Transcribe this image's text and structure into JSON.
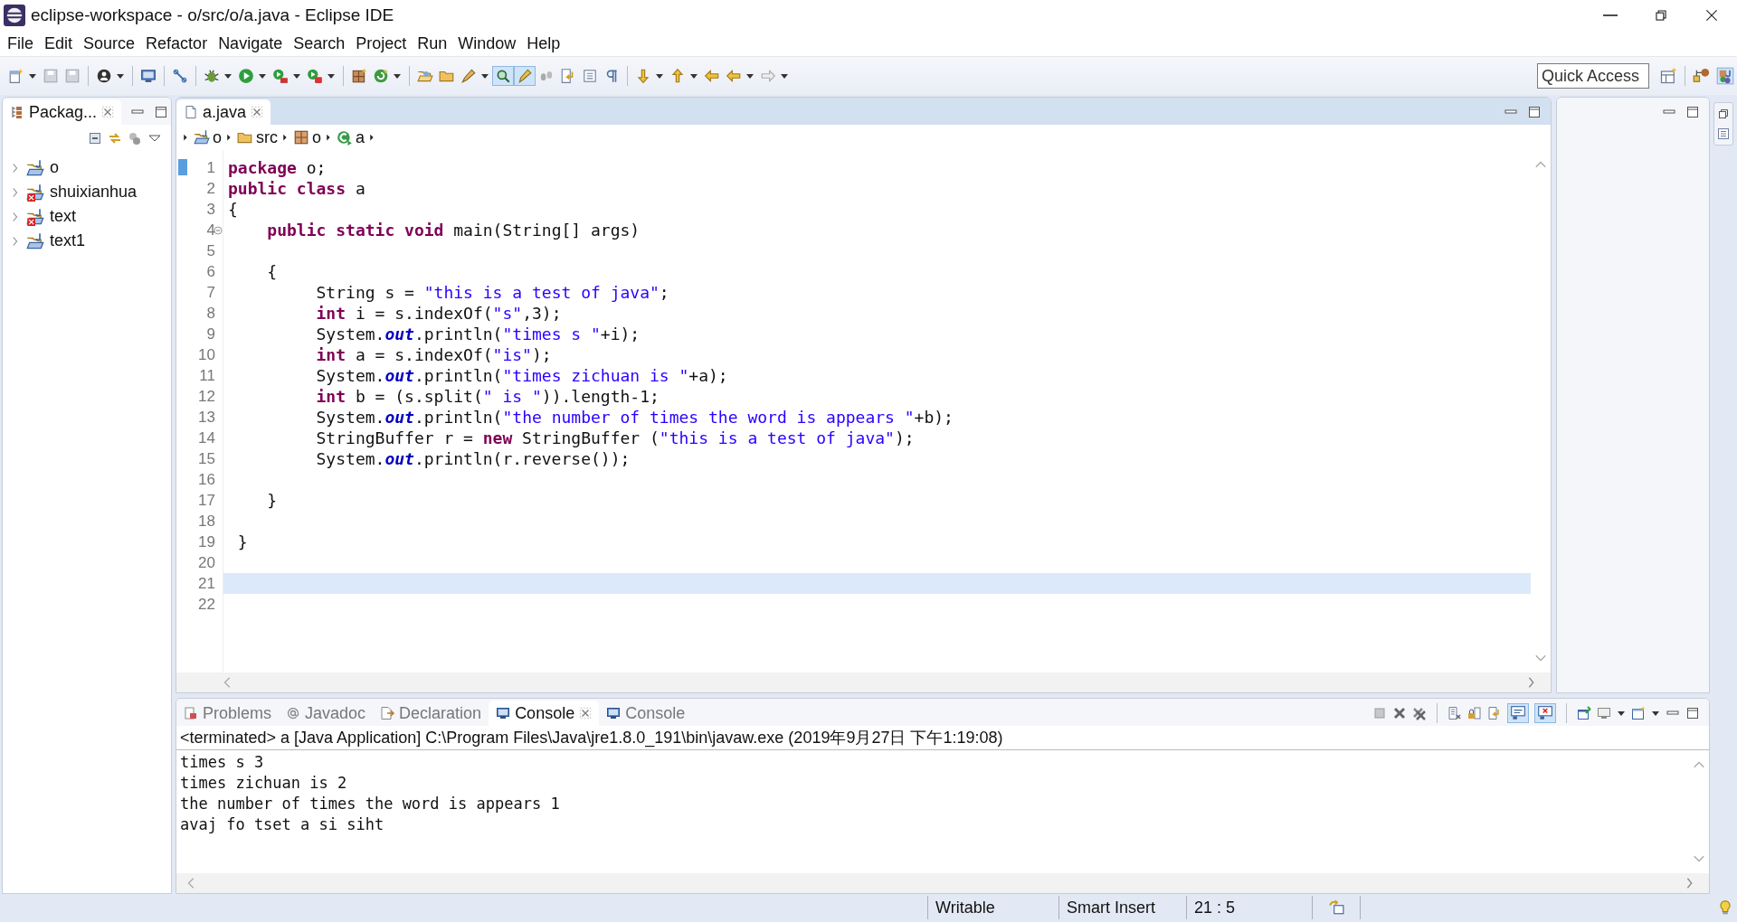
{
  "window": {
    "title": "eclipse-workspace - o/src/o/a.java - Eclipse IDE"
  },
  "menu": [
    "File",
    "Edit",
    "Source",
    "Refactor",
    "Navigate",
    "Search",
    "Project",
    "Run",
    "Window",
    "Help"
  ],
  "toolbar": {
    "toggles": [
      {
        "selected": true
      },
      {
        "selected": true
      }
    ],
    "quick_access": {
      "placeholder": "Quick Access"
    }
  },
  "package_explorer": {
    "tab": "Packag...",
    "items": [
      {
        "label": "o",
        "error": false,
        "expanded": false
      },
      {
        "label": "shuixianhua",
        "error": true,
        "expanded": false
      },
      {
        "label": "text",
        "error": true,
        "expanded": false
      },
      {
        "label": "text1",
        "error": false,
        "expanded": false
      }
    ]
  },
  "editor": {
    "tab": "a.java",
    "breadcrumb": [
      {
        "label": "o",
        "kind": "project"
      },
      {
        "label": "src",
        "kind": "folder"
      },
      {
        "label": "o",
        "kind": "package"
      },
      {
        "label": "a",
        "kind": "class"
      }
    ],
    "lines": [
      {
        "n": "1",
        "current": false,
        "segs": [
          {
            "kind": "keyword",
            "t": "package"
          },
          {
            "t": " o;"
          }
        ]
      },
      {
        "n": "2",
        "current": false,
        "segs": [
          {
            "kind": "keyword",
            "t": "public class"
          },
          {
            "t": " a"
          }
        ]
      },
      {
        "n": "3",
        "current": false,
        "segs": [
          {
            "t": "{"
          }
        ]
      },
      {
        "n": "4",
        "current": false,
        "expanded": true,
        "segs": [
          {
            "kind": "keyword",
            "t": "    public static void"
          },
          {
            "t": " main(String[] args)"
          }
        ]
      },
      {
        "n": "5",
        "current": false
      },
      {
        "n": "6",
        "current": false,
        "segs": [
          {
            "t": "    {"
          }
        ]
      },
      {
        "n": "7",
        "current": false,
        "segs": [
          {
            "t": "         String s = "
          },
          {
            "kind": "string",
            "t": "\"this is a test of java\""
          },
          {
            "t": ";"
          }
        ]
      },
      {
        "n": "8",
        "current": false,
        "segs": [
          {
            "kind": "keyword",
            "t": "         int"
          },
          {
            "t": " i = s.indexOf("
          },
          {
            "kind": "string",
            "t": "\"s\""
          },
          {
            "t": ",3);"
          }
        ]
      },
      {
        "n": "9",
        "current": false,
        "segs": [
          {
            "t": "         System."
          },
          {
            "kind": "field",
            "t": "out"
          },
          {
            "t": ".println("
          },
          {
            "kind": "string",
            "t": "\"times s \""
          },
          {
            "t": "+i);"
          }
        ]
      },
      {
        "n": "10",
        "current": false,
        "segs": [
          {
            "kind": "keyword",
            "t": "         int"
          },
          {
            "t": " a = s.indexOf("
          },
          {
            "kind": "string",
            "t": "\"is\""
          },
          {
            "t": ");"
          }
        ]
      },
      {
        "n": "11",
        "current": false,
        "segs": [
          {
            "t": "         System."
          },
          {
            "kind": "field",
            "t": "out"
          },
          {
            "t": ".println("
          },
          {
            "kind": "string",
            "t": "\"times zichuan is \""
          },
          {
            "t": "+a);"
          }
        ]
      },
      {
        "n": "12",
        "current": false,
        "segs": [
          {
            "kind": "keyword",
            "t": "         int"
          },
          {
            "t": " b = (s.split("
          },
          {
            "kind": "string",
            "t": "\" is \""
          },
          {
            "t": ")).length-1;"
          }
        ]
      },
      {
        "n": "13",
        "current": false,
        "segs": [
          {
            "t": "         System."
          },
          {
            "kind": "field",
            "t": "out"
          },
          {
            "t": ".println("
          },
          {
            "kind": "string",
            "t": "\"the number of times the word is appears \""
          },
          {
            "t": "+b);"
          }
        ]
      },
      {
        "n": "14",
        "current": false,
        "segs": [
          {
            "t": "         StringBuffer r = "
          },
          {
            "kind": "keyword",
            "t": "new"
          },
          {
            "t": " StringBuffer ("
          },
          {
            "kind": "string",
            "t": "\"this is a test of java\""
          },
          {
            "t": ");"
          }
        ]
      },
      {
        "n": "15",
        "current": false,
        "segs": [
          {
            "t": "         System."
          },
          {
            "kind": "field",
            "t": "out"
          },
          {
            "t": ".println(r.reverse());"
          }
        ]
      },
      {
        "n": "16",
        "current": false
      },
      {
        "n": "17",
        "current": false,
        "segs": [
          {
            "t": "    }"
          }
        ]
      },
      {
        "n": "18",
        "current": false
      },
      {
        "n": "19",
        "current": false,
        "segs": [
          {
            "t": " }"
          }
        ]
      },
      {
        "n": "20",
        "current": false
      },
      {
        "n": "21",
        "current": true
      },
      {
        "n": "22",
        "current": false
      }
    ]
  },
  "console": {
    "tabs": [
      {
        "label": "Problems",
        "kind": "problems",
        "selected": false
      },
      {
        "label": "Javadoc",
        "kind": "javadoc",
        "selected": false
      },
      {
        "label": "Declaration",
        "kind": "declaration",
        "selected": false
      },
      {
        "label": "Console",
        "kind": "console",
        "selected": true
      },
      {
        "label": "Console",
        "kind": "console",
        "selected": false
      }
    ],
    "toggles": [
      {
        "selected": true
      },
      {
        "selected": true
      }
    ],
    "header": "<terminated> a [Java Application] C:\\Program Files\\Java\\jre1.8.0_191\\bin\\javaw.exe (2019年9月27日 下午1:19:08)",
    "output": [
      "times s 3",
      "times zichuan is 2",
      "the number of times the word is appears 1",
      "avaj fo tset a si siht"
    ]
  },
  "status_bar": {
    "mode": "Writable",
    "insert": "Smart Insert",
    "position": "21 : 5"
  }
}
